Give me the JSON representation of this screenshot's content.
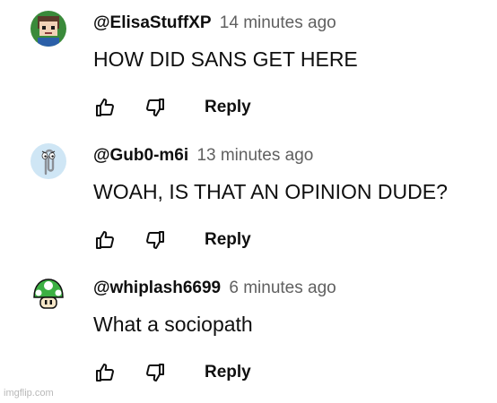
{
  "comments": [
    {
      "author": "@ElisaStuffXP",
      "time": "14 minutes ago",
      "text": "HOW DID SANS GET HERE",
      "reply_label": "Reply",
      "avatar_icon": "pixel-character-avatar-icon"
    },
    {
      "author": "@Gub0-m6i",
      "time": "13 minutes ago",
      "text": "WOAH, IS THAT AN OPINION DUDE?",
      "reply_label": "Reply",
      "avatar_icon": "paperclip-avatar-icon"
    },
    {
      "author": "@whiplash6699",
      "time": "6 minutes ago",
      "text": "What a sociopath",
      "reply_label": "Reply",
      "avatar_icon": "mushroom-avatar-icon"
    }
  ],
  "watermark": "imgflip.com",
  "colors": {
    "text": "#0f0f0f",
    "timestamp": "#606060",
    "watermark": "#b8b8b8"
  }
}
